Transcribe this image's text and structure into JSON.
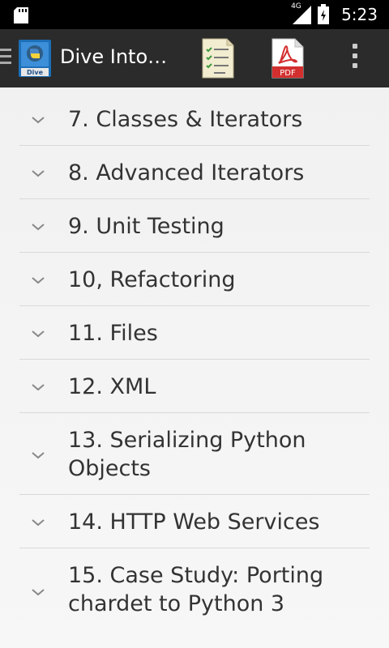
{
  "status_bar": {
    "network": "4G",
    "time": "5:23",
    "icons": [
      "sd-card-icon",
      "signal-icon",
      "battery-icon"
    ]
  },
  "app_bar": {
    "title": "Dive Into…",
    "logo_text": "Dive",
    "pdf_label": "PDF",
    "icons": [
      "menu-icon",
      "app-logo",
      "toc-icon",
      "pdf-icon",
      "overflow-menu-icon"
    ]
  },
  "chapters": [
    {
      "label": "7. Classes & Iterators"
    },
    {
      "label": "8. Advanced Iterators"
    },
    {
      "label": "9. Unit Testing"
    },
    {
      "label": "10, Refactoring"
    },
    {
      "label": "11. Files"
    },
    {
      "label": "12. XML"
    },
    {
      "label": "13. Serializing Python Objects"
    },
    {
      "label": "14. HTTP Web Services"
    },
    {
      "label": "15. Case Study: Porting chardet to Python 3"
    }
  ],
  "colors": {
    "status_bar": "#000000",
    "app_bar": "#2b2b2b",
    "list_bg": "#f3f3f3",
    "divider": "#d9d9d9",
    "text": "#333333",
    "pdf_red": "#d32f2f"
  }
}
